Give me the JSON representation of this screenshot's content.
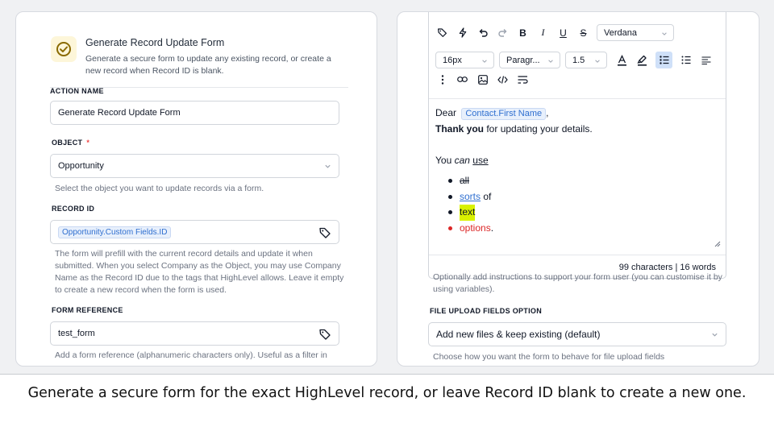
{
  "left_panel": {
    "header": {
      "title": "Generate Record Update Form",
      "description": "Generate a secure form to update any existing record, or create a new record when Record ID is blank."
    },
    "action_name": {
      "label": "ACTION NAME",
      "value": "Generate Record Update Form"
    },
    "object": {
      "label": "OBJECT",
      "required_mark": "*",
      "value": "Opportunity",
      "hint": "Select the object you want to update records via a form."
    },
    "record_id": {
      "label": "RECORD ID",
      "chip_parts": [
        "Opportunity",
        ".",
        "Custom Fields",
        ".",
        "ID"
      ],
      "hint": "The form will prefill with the current record details and update it when submitted. When you select Company as the Object, you may use Company Name as the Record ID due to the tags that HighLevel allows. Leave it empty to create a new record when the form is used."
    },
    "form_reference": {
      "label": "FORM REFERENCE",
      "value": "test_form",
      "hint": "Add a form reference (alphanumeric characters only). Useful as a filter in"
    }
  },
  "right_panel": {
    "toolbar": {
      "font_family": "Verdana",
      "font_size": "16px",
      "block_type": "Paragr...",
      "line_height": "1.5"
    },
    "content": {
      "dear": "Dear",
      "chip_parts": [
        "Contact",
        ".",
        "First Name"
      ],
      "comma": ",",
      "thanks_bold": "Thank you",
      "thanks_rest": " for updating your details.",
      "you": "You ",
      "can": "can",
      "use": "use",
      "bullets": [
        "all",
        "sorts",
        "of",
        "text",
        "options",
        "."
      ]
    },
    "counter": "99 characters | 16 words",
    "instructions_hint": "Optionally add instructions to support your form user (you can customise it by using variables).",
    "file_upload": {
      "label": "FILE UPLOAD FIELDS OPTION",
      "value": "Add new files & keep existing (default)",
      "hint": "Choose how you want the form to behave for file upload fields"
    }
  },
  "caption": "Generate a secure form for the exact HighLevel record, or leave Record ID blank to create a new one.",
  "colors": {
    "accent_yellow": "#fdf6d9",
    "chip_blue": "#2f6fd0",
    "highlight": "#d9f100",
    "red_text": "#dc2626",
    "required": "#ef4444"
  }
}
